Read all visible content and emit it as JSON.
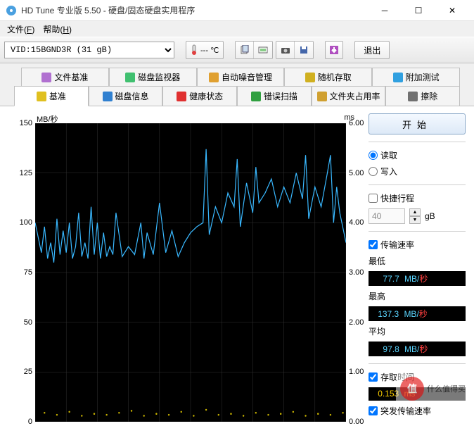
{
  "window": {
    "title": "HD Tune 专业版 5.50 - 硬盘/固态硬盘实用程序"
  },
  "menu": {
    "file": "文件",
    "file_key": "F",
    "help": "帮助",
    "help_key": "H"
  },
  "toolbar": {
    "drive_selected": "VID:15BGND3R (31 gB)",
    "temp": "--- ℃",
    "exit": "退出"
  },
  "tabs_row1": [
    {
      "label": "文件基准",
      "icon": "#b070d0"
    },
    {
      "label": "磁盘监视器",
      "icon": "#40c070"
    },
    {
      "label": "自动噪音管理",
      "icon": "#e0a030"
    },
    {
      "label": "随机存取",
      "icon": "#d0b020"
    },
    {
      "label": "附加测试",
      "icon": "#30a0e0"
    }
  ],
  "tabs_row2": [
    {
      "label": "基准",
      "icon": "#e0c020",
      "active": true
    },
    {
      "label": "磁盘信息",
      "icon": "#3080d0"
    },
    {
      "label": "健康状态",
      "icon": "#e03030"
    },
    {
      "label": "错误扫描",
      "icon": "#30a040"
    },
    {
      "label": "文件夹占用率",
      "icon": "#d0a030"
    },
    {
      "label": "擦除",
      "icon": "#707070"
    }
  ],
  "chart_data": {
    "type": "line",
    "title": "",
    "xlabel": "",
    "y_left": {
      "label": "MB/秒",
      "min": 0,
      "max": 150,
      "ticks": [
        0,
        25,
        50,
        75,
        100,
        125,
        150
      ]
    },
    "y_right": {
      "label": "ms",
      "min": 0.0,
      "max": 6.0,
      "ticks": [
        0.0,
        1.0,
        2.0,
        3.0,
        4.0,
        5.0,
        6.0
      ]
    },
    "x": {
      "min": 0,
      "max": 100
    },
    "series": [
      {
        "name": "传输速率",
        "color": "#39b8ff",
        "axis": "left",
        "x": [
          0,
          2,
          3,
          4,
          5,
          6,
          7,
          8,
          9,
          10,
          11,
          12,
          13,
          14,
          15,
          16,
          17,
          18,
          19,
          20,
          21,
          22,
          23,
          24,
          25,
          26,
          28,
          30,
          32,
          34,
          35,
          36,
          38,
          40,
          42,
          44,
          46,
          48,
          50,
          52,
          54,
          55,
          56,
          58,
          60,
          62,
          64,
          65,
          66,
          68,
          70,
          71,
          72,
          74,
          76,
          78,
          80,
          82,
          84,
          86,
          87,
          88,
          90,
          92,
          94,
          95,
          96,
          97,
          98,
          100
        ],
        "y": [
          100,
          85,
          98,
          82,
          90,
          80,
          102,
          84,
          96,
          85,
          100,
          82,
          88,
          105,
          83,
          90,
          82,
          108,
          84,
          100,
          82,
          95,
          83,
          88,
          84,
          105,
          83,
          88,
          84,
          100,
          82,
          95,
          84,
          110,
          85,
          96,
          83,
          90,
          95,
          98,
          100,
          137,
          94,
          108,
          100,
          115,
          108,
          132,
          98,
          120,
          105,
          128,
          110,
          115,
          122,
          108,
          118,
          110,
          125,
          112,
          134,
          102,
          118,
          108,
          125,
          134,
          100,
          118,
          105,
          90
        ]
      },
      {
        "name": "存取时间",
        "color": "#c9b300",
        "axis": "right",
        "x": [
          3,
          7,
          11,
          15,
          19,
          23,
          27,
          31,
          35,
          39,
          43,
          47,
          51,
          55,
          59,
          63,
          67,
          71,
          75,
          79,
          83,
          87,
          91,
          95,
          99
        ],
        "y": [
          0.18,
          0.14,
          0.2,
          0.12,
          0.16,
          0.14,
          0.18,
          0.22,
          0.12,
          0.16,
          0.14,
          0.2,
          0.12,
          0.24,
          0.14,
          0.16,
          0.12,
          0.18,
          0.14,
          0.16,
          0.2,
          0.12,
          0.16,
          0.14,
          0.18
        ]
      }
    ]
  },
  "side": {
    "start": "开始",
    "read": "读取",
    "write": "写入",
    "short_stroke": "快捷行程",
    "short_stroke_value": "40",
    "short_stroke_unit": "gB",
    "transfer_rate": "传输速率",
    "min_label": "最低",
    "min_value": "77.7",
    "max_label": "最高",
    "max_value": "137.3",
    "avg_label": "平均",
    "avg_value": "97.8",
    "rate_unit_mb": "MB/",
    "rate_unit_sec": "秒",
    "access_time": "存取时间",
    "access_value": "0.153",
    "access_unit": "ms",
    "burst_rate": "突发传输速率"
  },
  "watermark": {
    "text": "什么值得买"
  }
}
